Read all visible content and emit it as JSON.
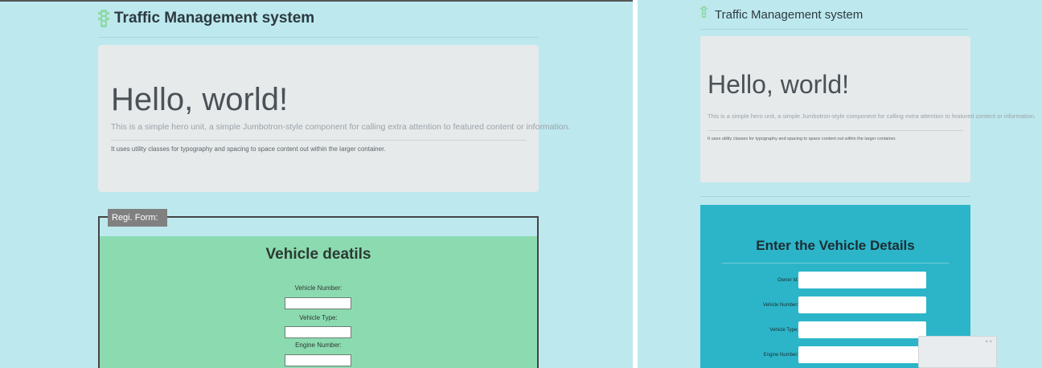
{
  "left": {
    "header": {
      "title": "Traffic Management system"
    },
    "jumbotron": {
      "heading": "Hello, world!",
      "lead": "This is a simple hero unit, a simple Jumbotron-style component for calling extra attention to featured content or information.",
      "body": "It uses utility classes for typography and spacing to space content out within the larger container."
    },
    "form": {
      "legend": "Regi. Form:",
      "title": "Vehicle deatils",
      "fields": [
        {
          "label": "Vehicle Number:",
          "value": ""
        },
        {
          "label": "Vehicle Type:",
          "value": ""
        },
        {
          "label": "Engine Number:",
          "value": ""
        }
      ]
    }
  },
  "right": {
    "header": {
      "title": "Traffic Management system"
    },
    "jumbotron": {
      "heading": "Hello, world!",
      "lead": "This is a simple hero unit, a simple Jumbotron-style component for calling extra attention to featured content or information.",
      "body": "It uses utility classes for typography and spacing to space content out within the larger container."
    },
    "form": {
      "title": "Enter the Vehicle Details",
      "fields": [
        {
          "label": "Owner Id:",
          "value": ""
        },
        {
          "label": "Vehicle Number:",
          "value": ""
        },
        {
          "label": "Vehicle Type:",
          "value": ""
        },
        {
          "label": "Engine Number:",
          "value": ""
        }
      ]
    },
    "toast": {
      "close": "× ×"
    }
  },
  "colors": {
    "page_bg": "#bde8ee",
    "jumbotron_bg": "#e6eaeb",
    "left_form_bg": "#8cdab0",
    "right_form_bg": "#2cb5c8",
    "icon_green": "#8fd9a8"
  },
  "icons": {
    "header": "traffic-light-icon"
  }
}
